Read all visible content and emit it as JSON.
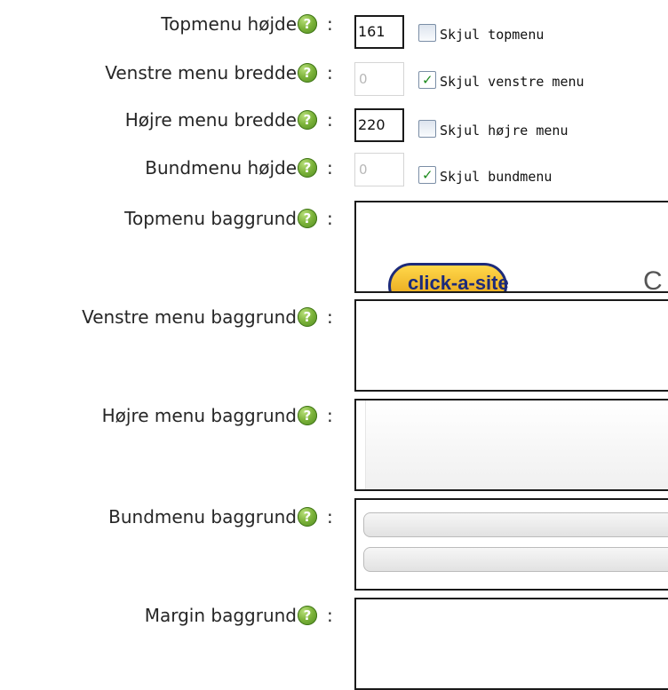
{
  "help_glyph": "?",
  "colon": ":",
  "fields": [
    {
      "label": "Topmenu højde",
      "value": "161",
      "disabled": false,
      "checkbox_label": "Skjul topmenu",
      "checked": false
    },
    {
      "label": "Venstre menu bredde",
      "value": "0",
      "disabled": true,
      "checkbox_label": "Skjul venstre menu",
      "checked": true
    },
    {
      "label": "Højre menu bredde",
      "value": "220",
      "disabled": false,
      "checkbox_label": "Skjul højre menu",
      "checked": false
    },
    {
      "label": "Bundmenu højde",
      "value": "0",
      "disabled": true,
      "checkbox_label": "Skjul bundmenu",
      "checked": true
    }
  ],
  "backgrounds": [
    {
      "label": "Topmenu baggrund",
      "preview": "logo",
      "logo_text": "click-a-site",
      "trailing_text": "C"
    },
    {
      "label": "Venstre menu baggrund",
      "preview": "blank"
    },
    {
      "label": "Højre menu baggrund",
      "preview": "gloss"
    },
    {
      "label": "Bundmenu baggrund",
      "preview": "bars"
    },
    {
      "label": "Margin baggrund",
      "preview": "blank"
    }
  ],
  "colors": {
    "help_icon": "#7cb33a",
    "check_mark": "#1c8a1c",
    "logo_fill": "#f5b82a",
    "logo_outline": "#1d2b7a"
  }
}
